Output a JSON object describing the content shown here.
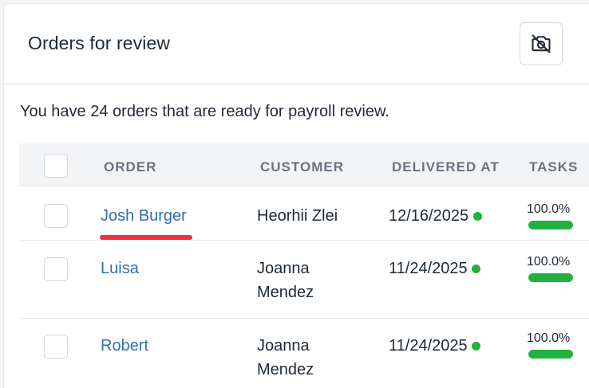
{
  "card": {
    "title": "Orders for review",
    "toolbar_icon": "camera-off-icon"
  },
  "intro_text": "You have 24 orders that are ready for payroll review.",
  "table": {
    "headers": [
      "ORDER",
      "CUSTOMER",
      "DELIVERED AT",
      "TASKS"
    ],
    "rows": [
      {
        "order": "Josh Burger",
        "customer": "Heorhii Zlei",
        "delivered_at": "12/16/2025",
        "tasks_label": "100.0%",
        "tasks_progress": 1.0,
        "status_color": "#22b041"
      },
      {
        "order": "Luisa",
        "customer": "Joanna Mendez",
        "delivered_at": "11/24/2025",
        "tasks_label": "100.0%",
        "tasks_progress": 1.0,
        "status_color": "#22b041"
      },
      {
        "order": "Robert",
        "customer": "Joanna Mendez",
        "delivered_at": "11/24/2025",
        "tasks_label": "100.0%",
        "tasks_progress": 1.0,
        "status_color": "#22b041"
      }
    ]
  },
  "colors": {
    "link": "#2f6fb0",
    "success": "#22b041",
    "highlight": "#e8323f"
  }
}
